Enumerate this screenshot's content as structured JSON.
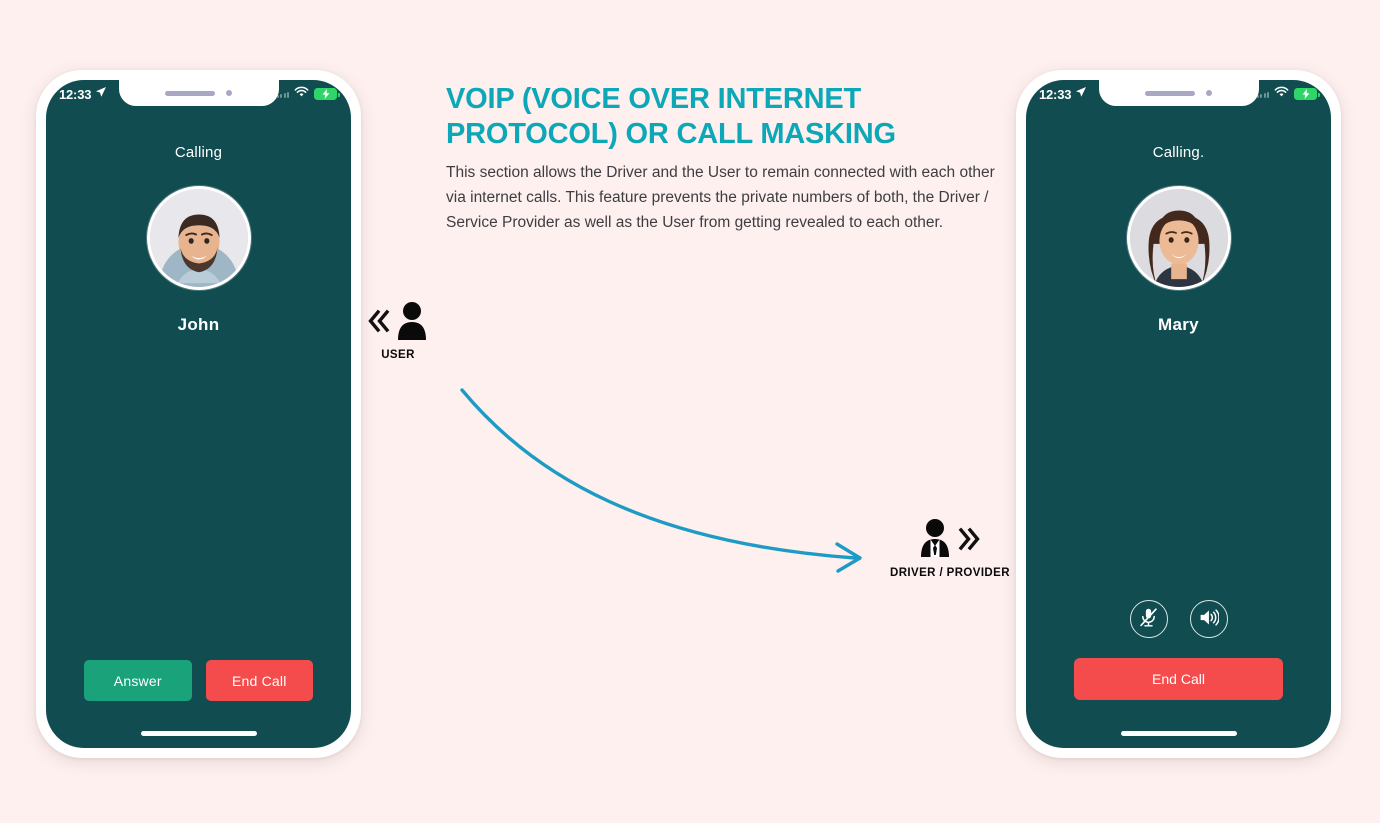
{
  "page": {
    "background_color": "#fdf0ee",
    "accent_color": "#0ca8b8",
    "arrow_color": "#1e9bc4"
  },
  "section": {
    "heading": "VOIP (VOICE OVER INTERNET PROTOCOL) OR CALL MASKING",
    "paragraph": "This section allows the Driver and the User to remain connected with each other via internet calls. This feature prevents the private numbers of both, the Driver / Service Provider as well as the User from getting revealed to each other."
  },
  "actors": {
    "user": {
      "label": "USER",
      "icon": "person-icon",
      "chevron": "chevron-double-left-icon"
    },
    "driver": {
      "label": "DRIVER / PROVIDER",
      "icon": "business-person-icon",
      "chevron": "chevron-double-right-icon"
    }
  },
  "phone_left": {
    "status_bar": {
      "time": "12:33",
      "location_icon": "location-arrow-icon",
      "signal_icon": "signal-dots-icon",
      "wifi_icon": "wifi-icon",
      "battery_icon": "battery-charging-icon",
      "battery_color": "#2fd566"
    },
    "call_status": "Calling",
    "caller_name": "John",
    "avatar_name": "avatar-john",
    "buttons": [
      {
        "label": "Answer",
        "name": "answer-button",
        "color": "#1aa37b"
      },
      {
        "label": "End Call",
        "name": "end-call-button",
        "color": "#f44c4c"
      }
    ]
  },
  "phone_right": {
    "status_bar": {
      "time": "12:33",
      "location_icon": "location-arrow-icon",
      "signal_icon": "signal-dots-icon",
      "wifi_icon": "wifi-icon",
      "battery_icon": "battery-charging-icon",
      "battery_color": "#2fd566"
    },
    "call_status": "Calling.",
    "caller_name": "Mary",
    "avatar_name": "avatar-mary",
    "controls": [
      {
        "name": "mute-microphone-button",
        "icon": "microphone-muted-icon"
      },
      {
        "name": "speaker-button",
        "icon": "speaker-loud-icon"
      }
    ],
    "end_call": {
      "label": "End Call",
      "color": "#f44c4c"
    }
  }
}
